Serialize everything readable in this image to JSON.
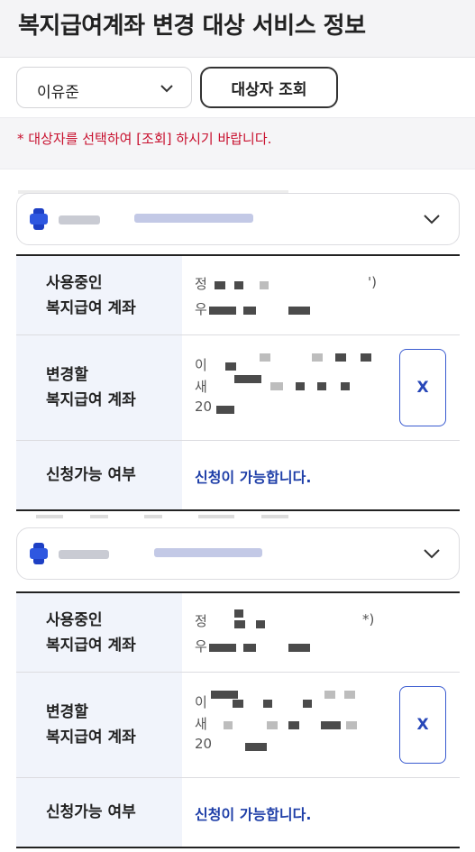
{
  "page": {
    "title": "복지급여계좌 변경 대상 서비스 정보"
  },
  "toolbar": {
    "select_value": "이유준",
    "search_label": "대상자 조회"
  },
  "notice": {
    "text": "* 대상자를 선택하여 [조회] 하시기 바랍니다."
  },
  "services": [
    {
      "current_account_label_1": "사용중인",
      "current_account_label_2": "복지급여 계좌",
      "current_line_1_prefix": "정",
      "current_line_1_suffix": "')",
      "current_line_2_prefix": "우",
      "new_account_label_1": "변경할",
      "new_account_label_2": "복지급여 계좌",
      "new_line_1_prefix": "이",
      "new_line_2_prefix": "새",
      "new_line_3_prefix": "20",
      "clear_label": "X",
      "eligibility_label": "신청가능 여부",
      "eligibility_value": "신청이 가능합니다."
    },
    {
      "current_account_label_1": "사용중인",
      "current_account_label_2": "복지급여 계좌",
      "current_line_1_prefix": "정",
      "current_line_1_suffix": "*)",
      "current_line_2_prefix": "우",
      "new_account_label_1": "변경할",
      "new_account_label_2": "복지급여 계좌",
      "new_line_1_prefix": "이",
      "new_line_2_prefix": "새",
      "new_line_3_prefix": "20",
      "clear_label": "X",
      "eligibility_label": "신청가능 여부",
      "eligibility_value": "신청이 가능합니다."
    }
  ],
  "colors": {
    "notice_red": "#c8102e",
    "status_blue": "#1f3fa8",
    "label_bg": "#f1f4fb"
  },
  "icons": {
    "select_chevron": "chevron-down-icon",
    "card_chevron": "chevron-down-icon",
    "service_logo": "service-logo-icon"
  }
}
